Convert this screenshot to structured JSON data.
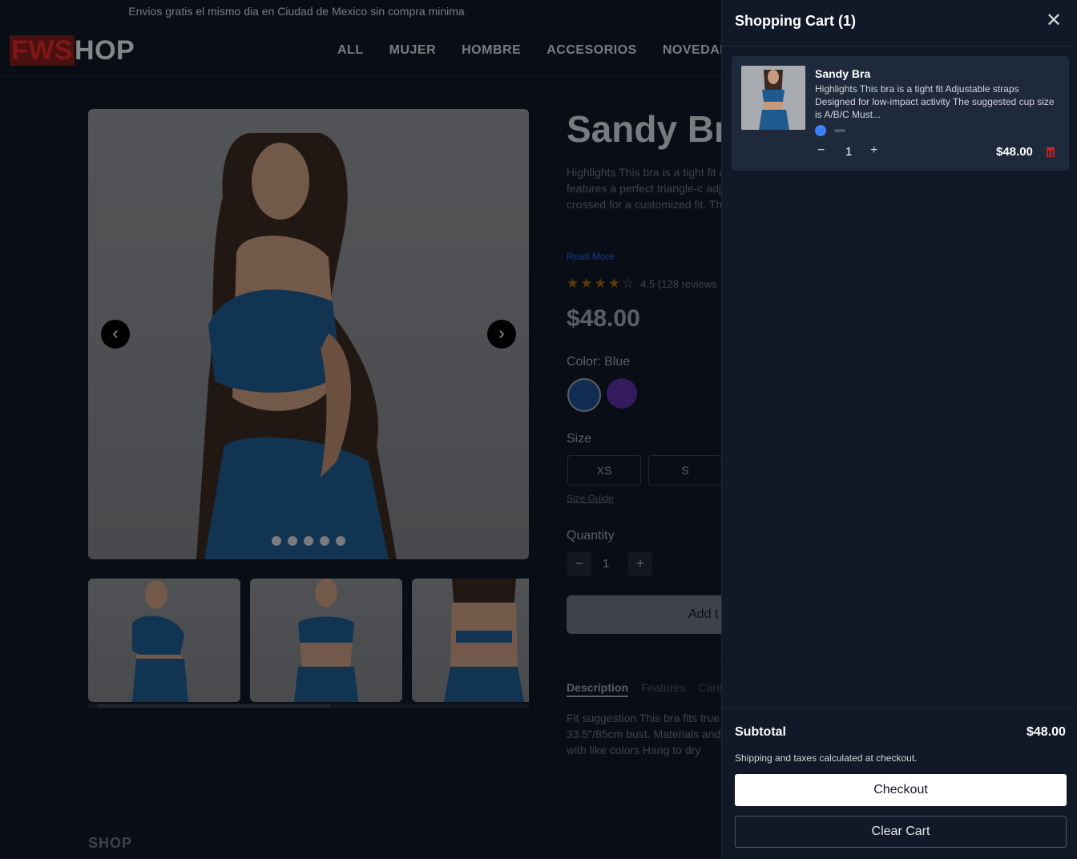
{
  "announcement": "Envios gratis el mismo dia en Ciudad de Mexico sin compra minima",
  "logo": {
    "part1": "FWS",
    "part2": "HOP"
  },
  "nav": [
    "ALL",
    "MUJER",
    "HOMBRE",
    "ACCESORIOS",
    "NOVEDADES"
  ],
  "product": {
    "title": "Sandy Br",
    "description": "Highlights This bra is a tight fit activity The suggested cup size Bra features a perfect triangle-c adjustable straps. Added hooks crossed for a customized fit. Th",
    "read_more": "Read More",
    "rating_text": "4.5 (128 reviews",
    "rating_value": 4.5,
    "price": "$48.00",
    "color_label": "Color: Blue",
    "colors": [
      "#1e4e8c",
      "#5b2fa0"
    ],
    "size_label": "Size",
    "sizes": [
      "XS",
      "S"
    ],
    "size_guide": "Size Guide",
    "quantity_label": "Quantity",
    "quantity": "1",
    "add_button": "Add t",
    "tabs": [
      "Description",
      "Features",
      "Care"
    ],
    "long_description": "Fit suggestion This bra fits true activities. We suggest sizing up 33.5\"/85cm bust. Materials and Polyester, 11% Elastane We rec with like colors Hang to dry"
  },
  "shop_label": "SHOP",
  "cart": {
    "title": "Shopping Cart (1)",
    "item": {
      "name": "Sandy Bra",
      "description": "Highlights This bra is a tight fit Adjustable straps Designed for low-impact activity The suggested cup size is A/B/C Must...",
      "quantity": "1",
      "price": "$48.00"
    },
    "subtotal_label": "Subtotal",
    "subtotal_value": "$48.00",
    "shipping_note": "Shipping and taxes calculated at checkout.",
    "checkout_label": "Checkout",
    "clear_label": "Clear Cart"
  }
}
